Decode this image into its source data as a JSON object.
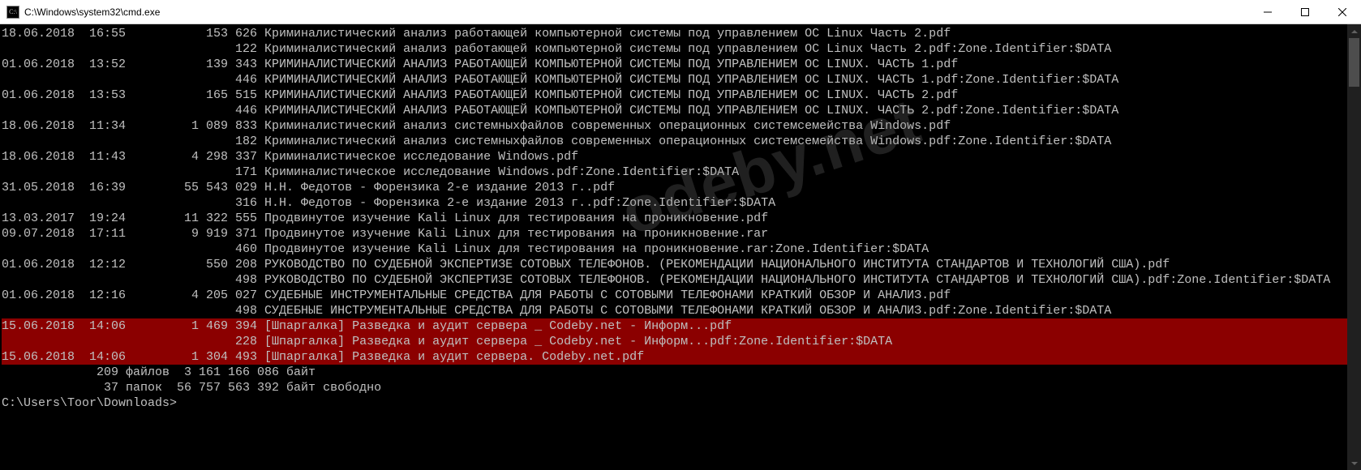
{
  "window": {
    "title": "C:\\Windows\\system32\\cmd.exe",
    "icon_label": "C:\\"
  },
  "watermark": "odeby.net",
  "lines": [
    {
      "hl": false,
      "text": "18.06.2018  16:55           153 626 Криминалистический анализ работающей компьютерной системы под управлением ОС Linux Часть 2.pdf"
    },
    {
      "hl": false,
      "text": "                                122 Криминалистический анализ работающей компьютерной системы под управлением ОС Linux Часть 2.pdf:Zone.Identifier:$DATA"
    },
    {
      "hl": false,
      "text": "01.06.2018  13:52           139 343 КРИМИНАЛИСТИЧЕСКИЙ АНАЛИЗ РАБОТАЮЩЕЙ КОМПЬЮТЕРНОЙ СИСТЕМЫ ПОД УПРАВЛЕНИЕМ ОС LINUX. ЧАСТЬ 1.pdf"
    },
    {
      "hl": false,
      "text": "                                446 КРИМИНАЛИСТИЧЕСКИЙ АНАЛИЗ РАБОТАЮЩЕЙ КОМПЬЮТЕРНОЙ СИСТЕМЫ ПОД УПРАВЛЕНИЕМ ОС LINUX. ЧАСТЬ 1.pdf:Zone.Identifier:$DATA"
    },
    {
      "hl": false,
      "text": "01.06.2018  13:53           165 515 КРИМИНАЛИСТИЧЕСКИЙ АНАЛИЗ РАБОТАЮЩЕЙ КОМПЬЮТЕРНОЙ СИСТЕМЫ ПОД УПРАВЛЕНИЕМ ОС LINUX. ЧАСТЬ 2.pdf"
    },
    {
      "hl": false,
      "text": "                                446 КРИМИНАЛИСТИЧЕСКИЙ АНАЛИЗ РАБОТАЮЩЕЙ КОМПЬЮТЕРНОЙ СИСТЕМЫ ПОД УПРАВЛЕНИЕМ ОС LINUX. ЧАСТЬ 2.pdf:Zone.Identifier:$DATA"
    },
    {
      "hl": false,
      "text": "18.06.2018  11:34         1 089 833 Криминалистический анализ системныхфайлов современных операционных системсемейства Windows.pdf"
    },
    {
      "hl": false,
      "text": "                                182 Криминалистический анализ системныхфайлов современных операционных системсемейства Windows.pdf:Zone.Identifier:$DATA"
    },
    {
      "hl": false,
      "text": "18.06.2018  11:43         4 298 337 Криминалистическое исследование Windows.pdf"
    },
    {
      "hl": false,
      "text": "                                171 Криминалистическое исследование Windows.pdf:Zone.Identifier:$DATA"
    },
    {
      "hl": false,
      "text": "31.05.2018  16:39        55 543 029 Н.Н. Федотов - Форензика 2-е издание 2013 г..pdf"
    },
    {
      "hl": false,
      "text": "                                316 Н.Н. Федотов - Форензика 2-е издание 2013 г..pdf:Zone.Identifier:$DATA"
    },
    {
      "hl": false,
      "text": "13.03.2017  19:24        11 322 555 Продвинутое изучение Kali Linux для тестирования на проникновение.pdf"
    },
    {
      "hl": false,
      "text": "09.07.2018  17:11         9 919 371 Продвинутое изучение Kali Linux для тестирования на проникновение.rar"
    },
    {
      "hl": false,
      "text": "                                460 Продвинутое изучение Kali Linux для тестирования на проникновение.rar:Zone.Identifier:$DATA"
    },
    {
      "hl": false,
      "text": "01.06.2018  12:12           550 208 РУКОВОДСТВО ПО СУДЕБНОЙ ЭКСПЕРТИЗЕ СОТОВЫХ ТЕЛЕФОНОВ. (РЕКОМЕНДАЦИИ НАЦИОНАЛЬНОГО ИНСТИТУТА СТАНДАРТОВ И ТЕХНОЛОГИЙ США).pdf"
    },
    {
      "hl": false,
      "text": "                                498 РУКОВОДСТВО ПО СУДЕБНОЙ ЭКСПЕРТИЗЕ СОТОВЫХ ТЕЛЕФОНОВ. (РЕКОМЕНДАЦИИ НАЦИОНАЛЬНОГО ИНСТИТУТА СТАНДАРТОВ И ТЕХНОЛОГИЙ США).pdf:Zone.Identifier:$DATA"
    },
    {
      "hl": false,
      "text": "01.06.2018  12:16         4 205 027 СУДЕБНЫЕ ИНСТРУМЕНТАЛЬНЫЕ СРЕДСТВА ДЛЯ РАБОТЫ С СОТОВЫМИ ТЕЛЕФОНАМИ КРАТКИЙ ОБЗОР И АНАЛИЗ.pdf"
    },
    {
      "hl": false,
      "text": "                                498 СУДЕБНЫЕ ИНСТРУМЕНТАЛЬНЫЕ СРЕДСТВА ДЛЯ РАБОТЫ С СОТОВЫМИ ТЕЛЕФОНАМИ КРАТКИЙ ОБЗОР И АНАЛИЗ.pdf:Zone.Identifier:$DATA"
    },
    {
      "hl": true,
      "text": "15.06.2018  14:06         1 469 394 [Шпаргалка] Разведка и аудит сервера _ Codeby.net - Информ...pdf"
    },
    {
      "hl": true,
      "text": "                                228 [Шпаргалка] Разведка и аудит сервера _ Codeby.net - Информ...pdf:Zone.Identifier:$DATA"
    },
    {
      "hl": true,
      "text": "15.06.2018  14:06         1 304 493 [Шпаргалка] Разведка и аудит сервера. Codeby.net.pdf"
    },
    {
      "hl": false,
      "text": "             209 файлов  3 161 166 086 байт"
    },
    {
      "hl": false,
      "text": "              37 папок  56 757 563 392 байт свободно"
    },
    {
      "hl": false,
      "text": ""
    },
    {
      "hl": false,
      "text": "C:\\Users\\Toor\\Downloads>"
    }
  ]
}
